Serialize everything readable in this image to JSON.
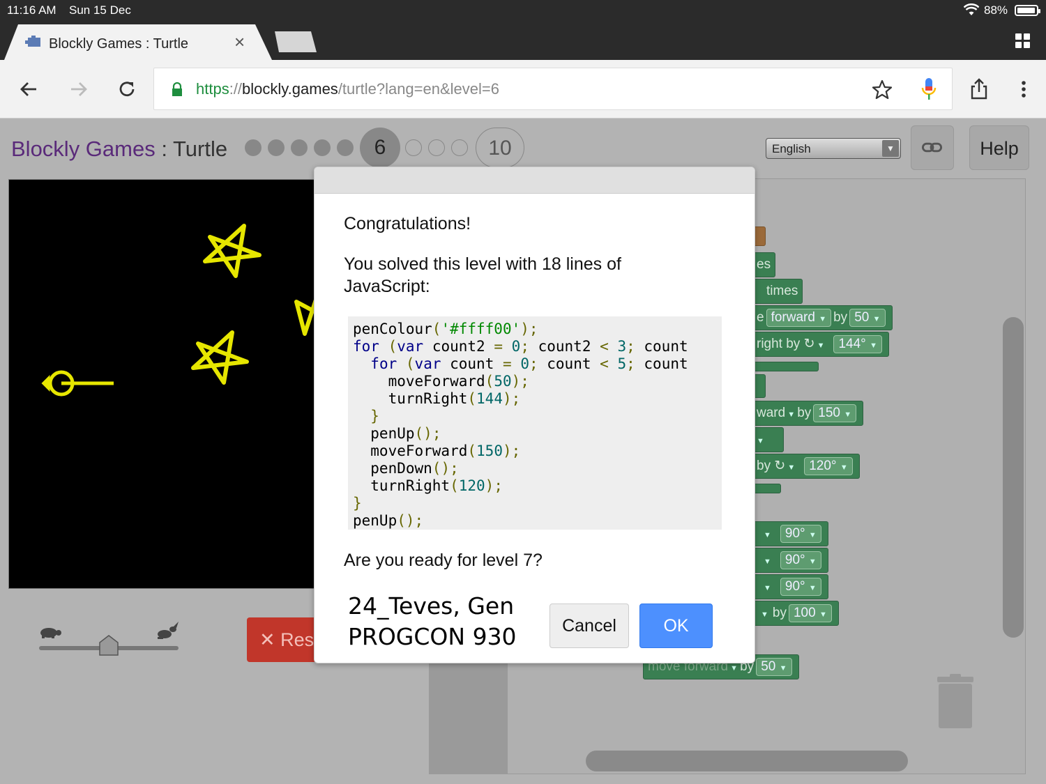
{
  "status_bar": {
    "time": "11:16 AM",
    "date": "Sun 15 Dec",
    "battery_pct": "88%"
  },
  "browser": {
    "tab_title": "Blockly Games : Turtle",
    "tab_close": "×",
    "url_scheme": "https",
    "url_sep": "://",
    "url_host": "blockly.games",
    "url_path": "/turtle?lang=en&level=6"
  },
  "header": {
    "brand": "Blockly Games",
    "separator": " : ",
    "title": "Turtle",
    "levels_total": 10,
    "current_level": "6",
    "last_level": "10",
    "language": "English",
    "help_label": "Help"
  },
  "speed_slider": {
    "value": 0.5
  },
  "reset_label": "Res",
  "workspace": {
    "blocks": [
      {
        "text": "es"
      },
      {
        "text": "times"
      },
      {
        "text": "e",
        "a": "forward",
        "b": "by",
        "c": "50"
      },
      {
        "text": "right by ↻",
        "c": "144°"
      },
      {
        "text": "ward",
        "b": "by",
        "c": "150"
      },
      {
        "text": "by ↻",
        "c": "120°"
      },
      {
        "c": "90°"
      },
      {
        "c": "90°"
      },
      {
        "c": "90°"
      },
      {
        "b": "by",
        "c": "100"
      },
      {
        "text": "move forward",
        "b": "by",
        "c": "50"
      }
    ]
  },
  "dialog": {
    "heading": "Congratulations!",
    "message": "You solved this level with 18 lines of JavaScript:",
    "question": "Are you ready for level 7?",
    "cancel_label": "Cancel",
    "ok_label": "OK",
    "name_line1": "24_Teves, Gen",
    "name_line2": "PROGCON 930",
    "code_lines": [
      "penColour('#ffff00');",
      "for (var count2 = 0; count2 < 3; count",
      "  for (var count = 0; count < 5; count",
      "    moveForward(50);",
      "    turnRight(144);",
      "  }",
      "  penUp();",
      "  moveForward(150);",
      "  penDown();",
      "  turnRight(120);",
      "}",
      "penUp();"
    ]
  },
  "colors": {
    "pen": "#ffff00",
    "ok_button": "#4d90fe",
    "reset_button": "#c1362a",
    "block_green": "#3a7f52"
  }
}
